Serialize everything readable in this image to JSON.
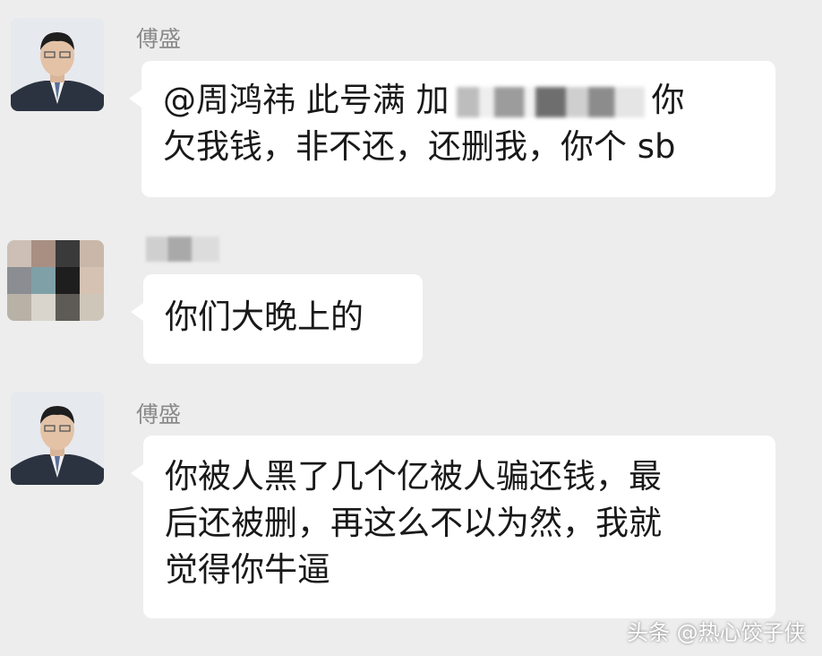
{
  "messages": [
    {
      "sender": "傅盛",
      "avatar": "portrait-icon",
      "lines": [
        "@周鸿祎 此号满 加",
        "你",
        "欠我钱，非不还，还删我，你个 sb"
      ]
    },
    {
      "sender": "",
      "avatar": "blurred-avatar-icon",
      "lines": [
        "你们大晚上的"
      ]
    },
    {
      "sender": "傅盛",
      "avatar": "portrait-icon",
      "lines": [
        "你被人黑了几个亿被人骗还钱，最",
        "后还被删，再这么不以为然，我就",
        "觉得你牛逼"
      ]
    }
  ],
  "watermark": "头条 @热心饺子侠",
  "colors": {
    "background": "#ededed",
    "bubble": "#ffffff",
    "sender": "#8a8a8a",
    "text": "#191919"
  }
}
